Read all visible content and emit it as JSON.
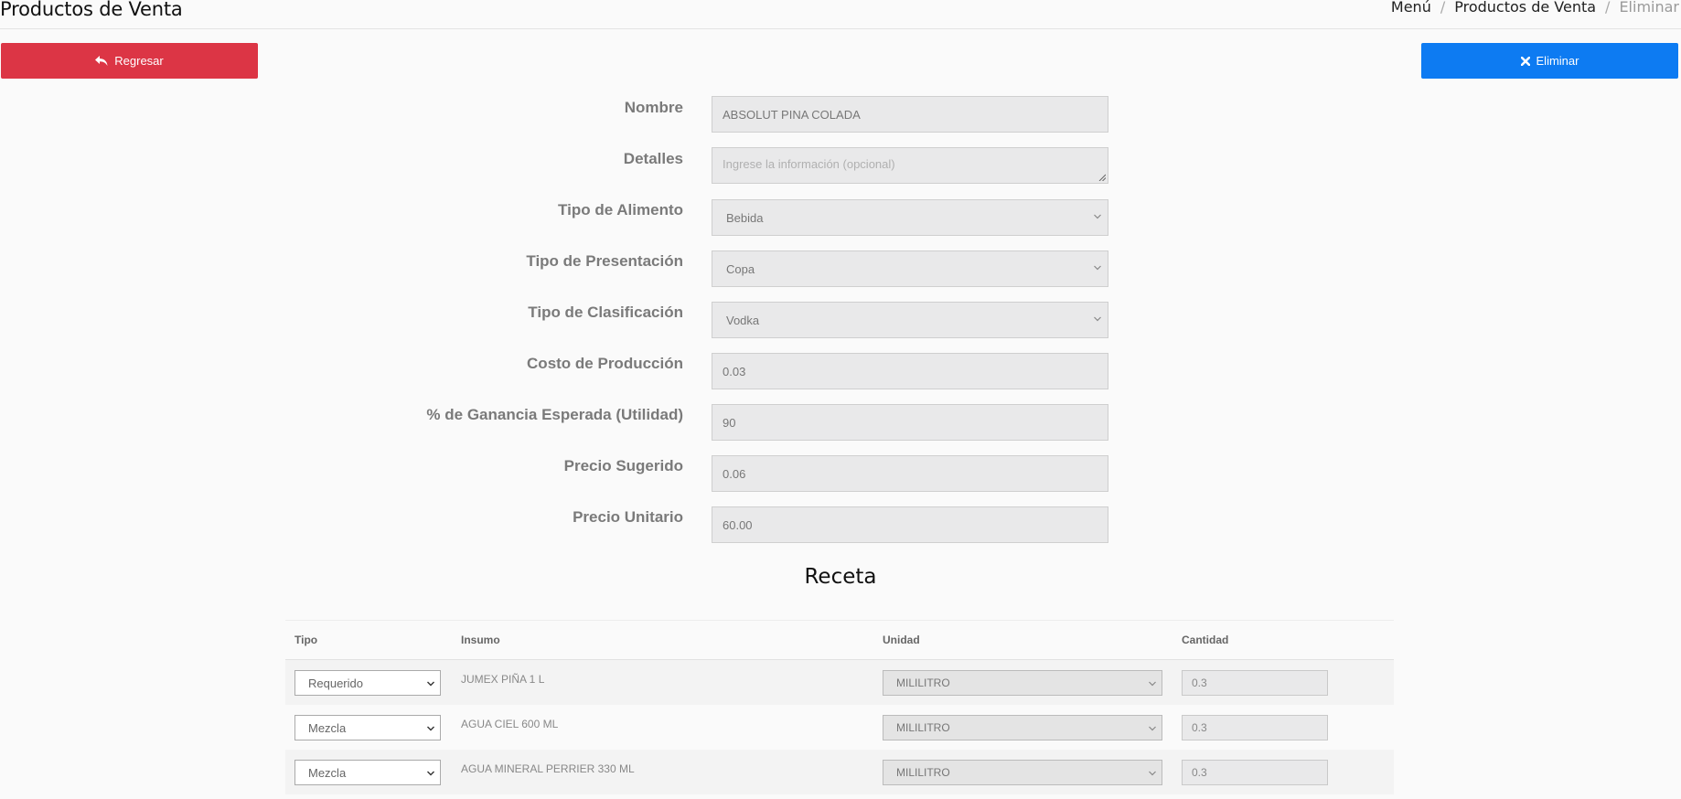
{
  "header": {
    "title": "Productos de Venta",
    "breadcrumb": [
      "Menú",
      "Productos de Venta",
      "Eliminar"
    ]
  },
  "buttons": {
    "back_label": "Regresar",
    "delete_label": "Eliminar"
  },
  "form": {
    "fields": [
      {
        "label": "Nombre",
        "value": "ABSOLUT  PINA COLADA",
        "kind": "input"
      },
      {
        "label": "Detalles",
        "placeholder": "Ingrese la información (opcional)",
        "kind": "textarea"
      },
      {
        "label": "Tipo de Alimento",
        "value": "Bebida",
        "kind": "select"
      },
      {
        "label": "Tipo de Presentación",
        "value": "Copa",
        "kind": "select"
      },
      {
        "label": "Tipo de Clasificación",
        "value": "Vodka",
        "kind": "select"
      },
      {
        "label": "Costo de Producción",
        "value": "0.03",
        "kind": "input"
      },
      {
        "label": "% de Ganancia Esperada (Utilidad)",
        "value": "90",
        "kind": "input"
      },
      {
        "label": "Precio Sugerido",
        "value": "0.06",
        "kind": "input"
      },
      {
        "label": "Precio Unitario",
        "value": "60.00",
        "kind": "input"
      }
    ]
  },
  "receta": {
    "title": "Receta",
    "columns": [
      "Tipo",
      "Insumo",
      "Unidad",
      "Cantidad"
    ],
    "rows": [
      {
        "tipo": "Requerido",
        "insumo": "JUMEX PIÑA 1 L",
        "unidad": "MILILITRO",
        "cantidad": "0.3"
      },
      {
        "tipo": "Mezcla",
        "insumo": "AGUA CIEL 600 ML",
        "unidad": "MILILITRO",
        "cantidad": "0.3"
      },
      {
        "tipo": "Mezcla",
        "insumo": "AGUA MINERAL PERRIER 330 ML",
        "unidad": "MILILITRO",
        "cantidad": "0.3"
      }
    ]
  },
  "colors": {
    "back_button": "#dc3545",
    "delete_button": "#0d7bf2"
  },
  "icons": {
    "back": "reply-arrow-icon",
    "delete": "times-icon",
    "select": "chevron-down-icon",
    "textarea": "resize-grip-icon"
  }
}
